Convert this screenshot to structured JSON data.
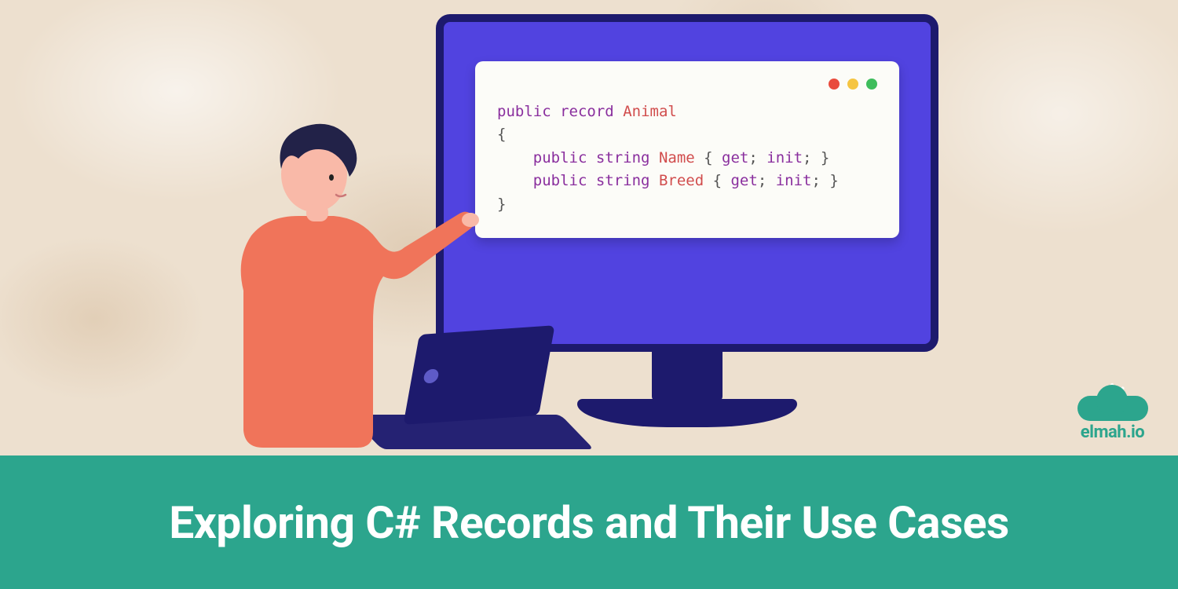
{
  "banner": {
    "title": "Exploring C# Records and Their Use Cases"
  },
  "code": {
    "tokens": [
      [
        {
          "t": "public",
          "c": "kw"
        },
        {
          "t": " ",
          "c": ""
        },
        {
          "t": "record",
          "c": "kw"
        },
        {
          "t": " ",
          "c": ""
        },
        {
          "t": "Animal",
          "c": "name"
        }
      ],
      [
        {
          "t": "{",
          "c": "punct"
        }
      ],
      [
        {
          "t": "    ",
          "c": ""
        },
        {
          "t": "public",
          "c": "kw"
        },
        {
          "t": " ",
          "c": ""
        },
        {
          "t": "string",
          "c": "kw"
        },
        {
          "t": " ",
          "c": ""
        },
        {
          "t": "Name",
          "c": "name"
        },
        {
          "t": " { ",
          "c": "punct"
        },
        {
          "t": "get",
          "c": "kw"
        },
        {
          "t": "; ",
          "c": "punct"
        },
        {
          "t": "init",
          "c": "kw"
        },
        {
          "t": "; }",
          "c": "punct"
        }
      ],
      [
        {
          "t": "    ",
          "c": ""
        },
        {
          "t": "public",
          "c": "kw"
        },
        {
          "t": " ",
          "c": ""
        },
        {
          "t": "string",
          "c": "kw"
        },
        {
          "t": " ",
          "c": ""
        },
        {
          "t": "Breed",
          "c": "name"
        },
        {
          "t": " { ",
          "c": "punct"
        },
        {
          "t": "get",
          "c": "kw"
        },
        {
          "t": "; ",
          "c": "punct"
        },
        {
          "t": "init",
          "c": "kw"
        },
        {
          "t": "; }",
          "c": "punct"
        }
      ],
      [
        {
          "t": "}",
          "c": "punct"
        }
      ]
    ]
  },
  "logo": {
    "text": "elmah.io"
  },
  "window": {
    "dots": [
      "red",
      "yellow",
      "green"
    ]
  }
}
